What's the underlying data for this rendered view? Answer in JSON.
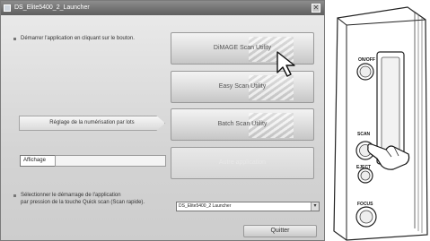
{
  "window": {
    "title": "DS_Elite5400_2_Launcher",
    "close_label": "✕"
  },
  "launch_hint": "Démarrer l'application en cliquant sur le bouton.",
  "buttons": {
    "dimage_scan": "DiMAGE Scan Utility",
    "easy_scan": "Easy Scan Utility",
    "batch_scan": "Batch Scan Utility",
    "autre": "Autre application"
  },
  "batch_setting_button": "Réglage de la numérisation par lots",
  "affichage_label": "Affichage",
  "quickscan_hint_line1": "Sélectionner le démarrage de l'application",
  "quickscan_hint_line2": "par pression de la touche Quick scan (Scan rapide).",
  "quickscan_select_value": "DS_Elite5400_2 Launcher",
  "quit_button": "Quitter",
  "device": {
    "on_off_label": "ON/OFF",
    "scan_label": "SCAN",
    "eject_label": "EJECT",
    "focus_label": "FOCUS"
  }
}
